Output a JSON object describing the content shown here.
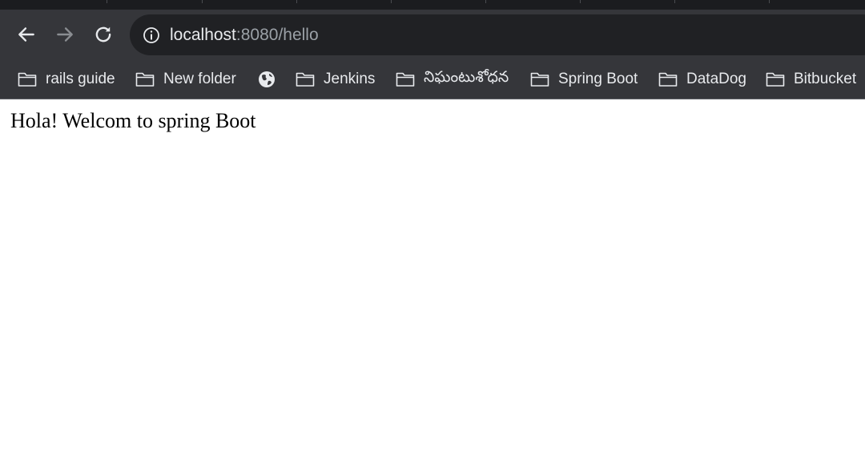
{
  "address_bar": {
    "host": "localhost",
    "rest": ":8080/hello"
  },
  "bookmarks": [
    {
      "label": "rails guide",
      "icon": "folder-icon"
    },
    {
      "label": "New folder",
      "icon": "folder-icon"
    },
    {
      "label": "",
      "icon": "globe-icon"
    },
    {
      "label": "Jenkins",
      "icon": "folder-icon"
    },
    {
      "label": "నిఘంటుశోధన",
      "icon": "folder-icon"
    },
    {
      "label": "Spring Boot",
      "icon": "folder-icon"
    },
    {
      "label": "DataDog",
      "icon": "folder-icon"
    },
    {
      "label": "Bitbucket",
      "icon": "folder-icon"
    }
  ],
  "page": {
    "text": "Hola! Welcom to spring Boot"
  },
  "colors": {
    "toolbar_bg": "#35363a",
    "omnibox_bg": "#202124",
    "text_light": "#e8eaed",
    "text_dim": "#9aa0a6"
  }
}
